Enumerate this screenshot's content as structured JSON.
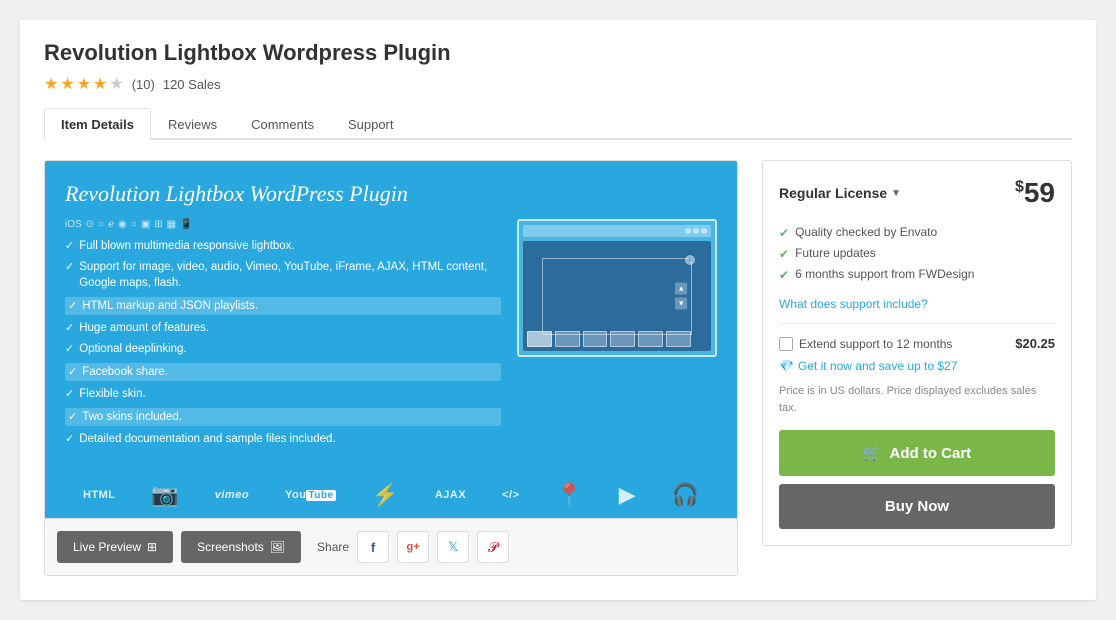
{
  "product": {
    "title": "Revolution Lightbox Wordpress Plugin",
    "rating": 4,
    "rating_max": 5,
    "rating_count": "(10)",
    "sales": "120 Sales"
  },
  "tabs": [
    {
      "label": "Item Details",
      "active": true
    },
    {
      "label": "Reviews",
      "active": false
    },
    {
      "label": "Comments",
      "active": false
    },
    {
      "label": "Support",
      "active": false
    }
  ],
  "preview": {
    "title": "Revolution Lightbox WordPress Plugin",
    "features": [
      "Full blown multimedia responsive lightbox.",
      "Support for image, video, audio, Vimeo, YouTube, iFrame, AJAX, HTML content, Google maps, flash.",
      "HTML markup and JSON playlists.",
      "Huge amount of features.",
      "Optional deeplinking.",
      "Facebook share.",
      "Flexible skin.",
      "Two skins included.",
      "Detailed documentation and sample files included."
    ]
  },
  "action_buttons": {
    "live_preview": "Live Preview",
    "screenshots": "Screenshots",
    "share": "Share"
  },
  "license": {
    "type": "Regular License",
    "currency": "$",
    "price": "59",
    "features": [
      "Quality checked by Envato",
      "Future updates",
      "6 months support from FWDesign"
    ],
    "support_link": "What does support include?",
    "extend_label": "Extend support to 12 months",
    "extend_price": "$20.25",
    "save_label": "Get it now and save up to $27",
    "price_note": "Price is in US dollars. Price displayed excludes sales tax.",
    "add_to_cart": "Add to Cart",
    "buy_now": "Buy Now"
  }
}
